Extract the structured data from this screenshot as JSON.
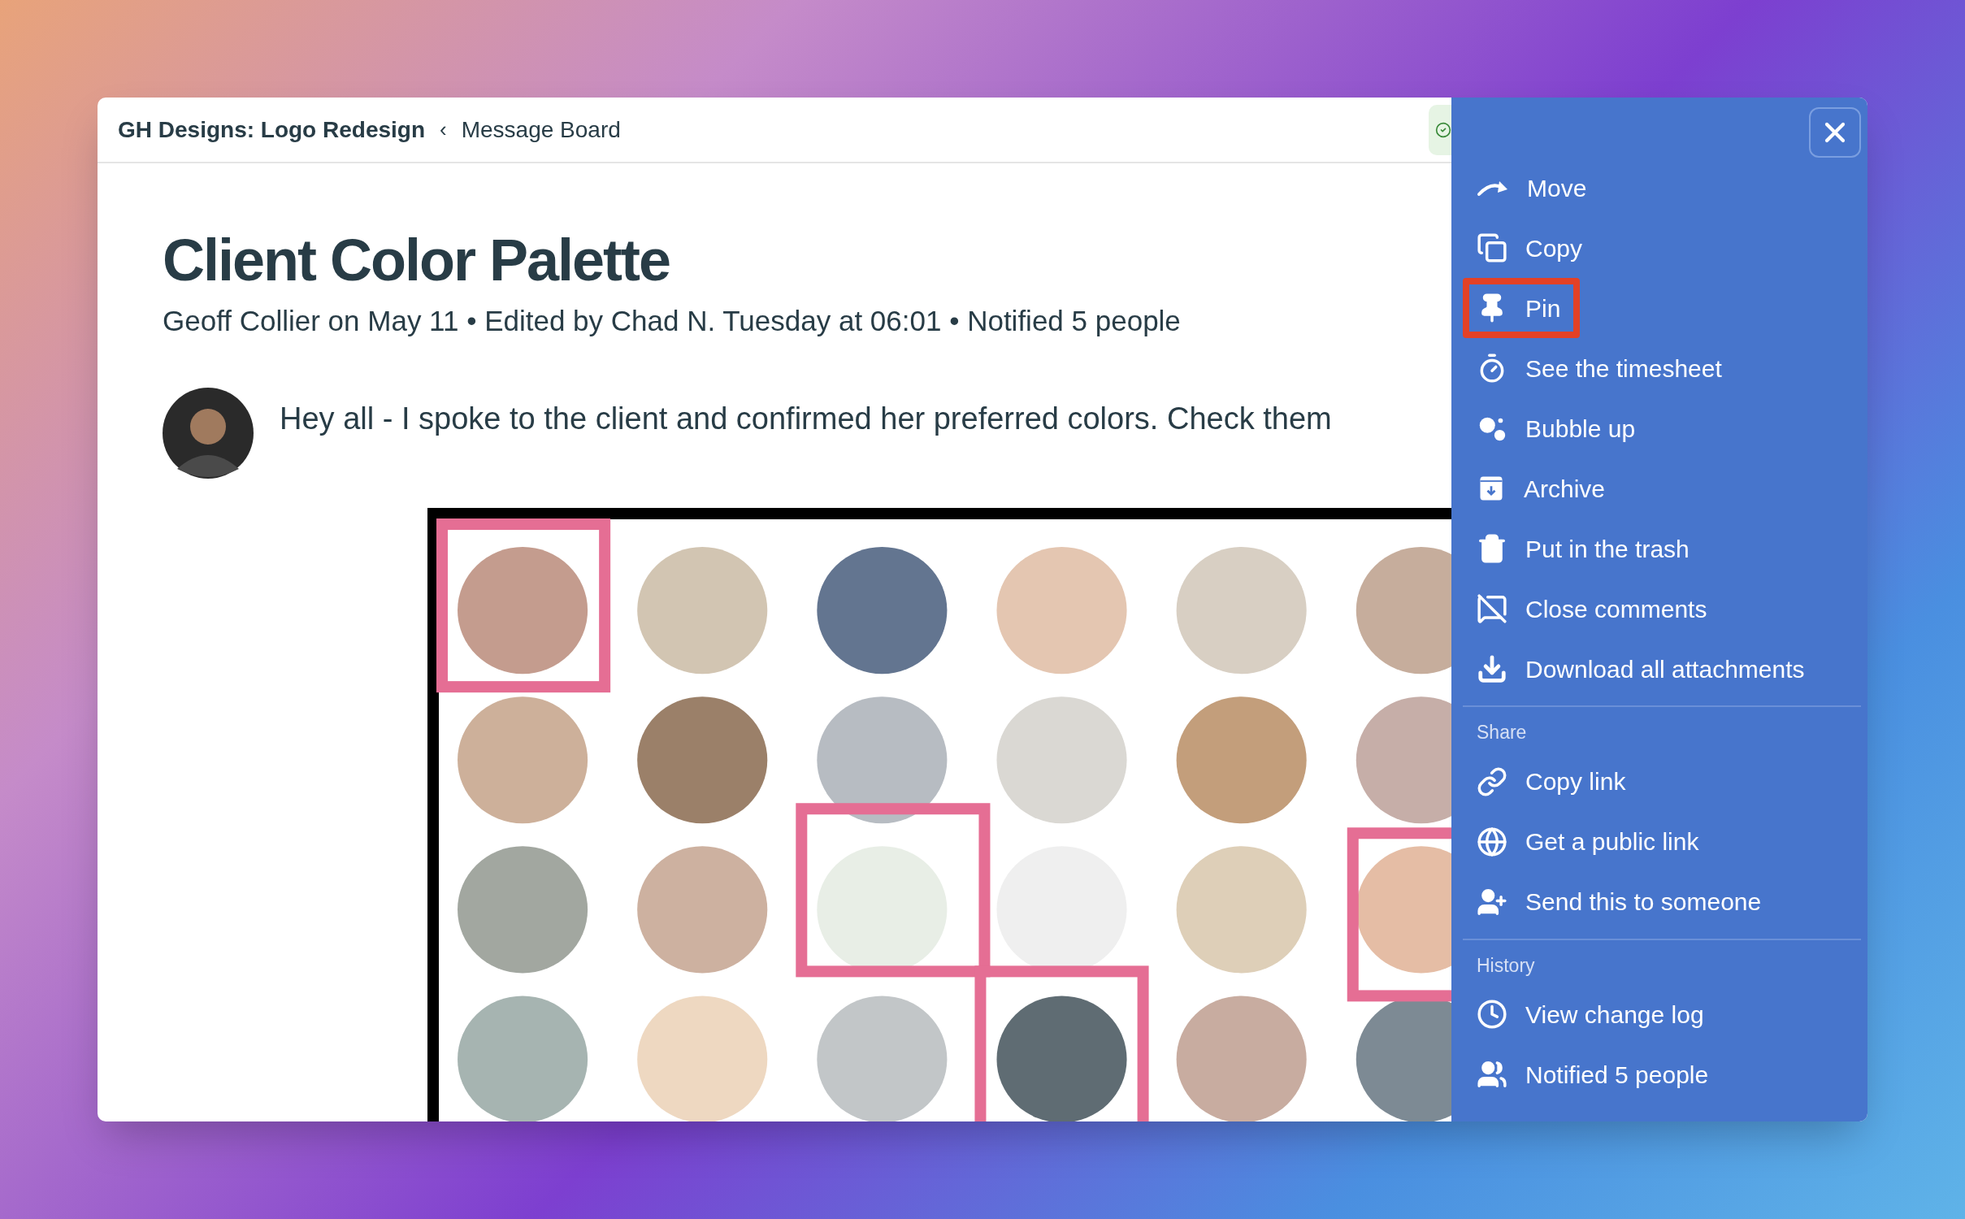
{
  "breadcrumb": {
    "project": "GH Designs: Logo Redesign",
    "separator": "‹",
    "section": "Message Board"
  },
  "post": {
    "title": "Client Color Palette",
    "meta": "Geoff Collier on May 11 • Edited by Chad N. Tuesday at 06:01 • Notified 5 people",
    "message": "Hey all - I spoke to the client and confirmed her preferred colors. Check them"
  },
  "menu": {
    "groups": [
      {
        "items": [
          {
            "label": "Move",
            "kind": "move",
            "highlighted": false
          },
          {
            "label": "Copy",
            "kind": "copy",
            "highlighted": false
          },
          {
            "label": "Pin",
            "kind": "pin",
            "highlighted": true
          },
          {
            "label": "See the timesheet",
            "kind": "timer",
            "highlighted": false
          },
          {
            "label": "Bubble up",
            "kind": "bubbles",
            "highlighted": false
          },
          {
            "label": "Archive",
            "kind": "archive",
            "highlighted": false
          },
          {
            "label": "Put in the trash",
            "kind": "trash",
            "highlighted": false
          },
          {
            "label": "Close comments",
            "kind": "comments-off",
            "highlighted": false
          },
          {
            "label": "Download all attachments",
            "kind": "download",
            "highlighted": false
          }
        ]
      },
      {
        "heading": "Share",
        "items": [
          {
            "label": "Copy link",
            "kind": "link",
            "highlighted": false
          },
          {
            "label": "Get a public link",
            "kind": "globe",
            "highlighted": false
          },
          {
            "label": "Send this to someone",
            "kind": "user-plus",
            "highlighted": false
          }
        ]
      },
      {
        "heading": "History",
        "items": [
          {
            "label": "View change log",
            "kind": "clock",
            "highlighted": false
          },
          {
            "label": "Notified 5 people",
            "kind": "users",
            "highlighted": false
          }
        ]
      }
    ]
  }
}
